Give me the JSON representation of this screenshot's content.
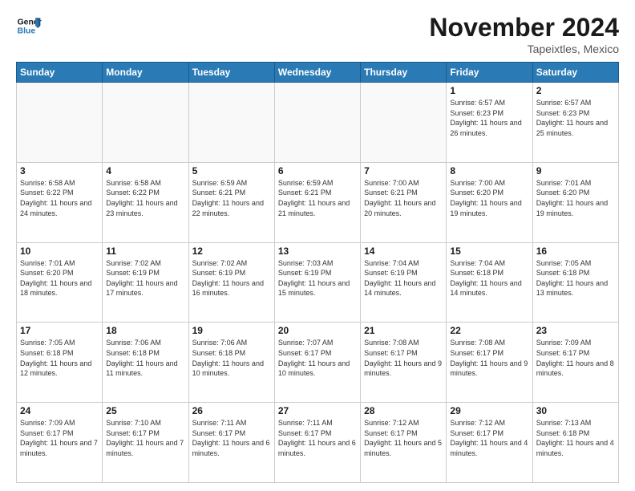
{
  "logo": {
    "line1": "General",
    "line2": "Blue"
  },
  "title": "November 2024",
  "location": "Tapeixtles, Mexico",
  "days_header": [
    "Sunday",
    "Monday",
    "Tuesday",
    "Wednesday",
    "Thursday",
    "Friday",
    "Saturday"
  ],
  "weeks": [
    [
      {
        "day": "",
        "detail": ""
      },
      {
        "day": "",
        "detail": ""
      },
      {
        "day": "",
        "detail": ""
      },
      {
        "day": "",
        "detail": ""
      },
      {
        "day": "",
        "detail": ""
      },
      {
        "day": "1",
        "detail": "Sunrise: 6:57 AM\nSunset: 6:23 PM\nDaylight: 11 hours\nand 26 minutes."
      },
      {
        "day": "2",
        "detail": "Sunrise: 6:57 AM\nSunset: 6:23 PM\nDaylight: 11 hours\nand 25 minutes."
      }
    ],
    [
      {
        "day": "3",
        "detail": "Sunrise: 6:58 AM\nSunset: 6:22 PM\nDaylight: 11 hours\nand 24 minutes."
      },
      {
        "day": "4",
        "detail": "Sunrise: 6:58 AM\nSunset: 6:22 PM\nDaylight: 11 hours\nand 23 minutes."
      },
      {
        "day": "5",
        "detail": "Sunrise: 6:59 AM\nSunset: 6:21 PM\nDaylight: 11 hours\nand 22 minutes."
      },
      {
        "day": "6",
        "detail": "Sunrise: 6:59 AM\nSunset: 6:21 PM\nDaylight: 11 hours\nand 21 minutes."
      },
      {
        "day": "7",
        "detail": "Sunrise: 7:00 AM\nSunset: 6:21 PM\nDaylight: 11 hours\nand 20 minutes."
      },
      {
        "day": "8",
        "detail": "Sunrise: 7:00 AM\nSunset: 6:20 PM\nDaylight: 11 hours\nand 19 minutes."
      },
      {
        "day": "9",
        "detail": "Sunrise: 7:01 AM\nSunset: 6:20 PM\nDaylight: 11 hours\nand 19 minutes."
      }
    ],
    [
      {
        "day": "10",
        "detail": "Sunrise: 7:01 AM\nSunset: 6:20 PM\nDaylight: 11 hours\nand 18 minutes."
      },
      {
        "day": "11",
        "detail": "Sunrise: 7:02 AM\nSunset: 6:19 PM\nDaylight: 11 hours\nand 17 minutes."
      },
      {
        "day": "12",
        "detail": "Sunrise: 7:02 AM\nSunset: 6:19 PM\nDaylight: 11 hours\nand 16 minutes."
      },
      {
        "day": "13",
        "detail": "Sunrise: 7:03 AM\nSunset: 6:19 PM\nDaylight: 11 hours\nand 15 minutes."
      },
      {
        "day": "14",
        "detail": "Sunrise: 7:04 AM\nSunset: 6:19 PM\nDaylight: 11 hours\nand 14 minutes."
      },
      {
        "day": "15",
        "detail": "Sunrise: 7:04 AM\nSunset: 6:18 PM\nDaylight: 11 hours\nand 14 minutes."
      },
      {
        "day": "16",
        "detail": "Sunrise: 7:05 AM\nSunset: 6:18 PM\nDaylight: 11 hours\nand 13 minutes."
      }
    ],
    [
      {
        "day": "17",
        "detail": "Sunrise: 7:05 AM\nSunset: 6:18 PM\nDaylight: 11 hours\nand 12 minutes."
      },
      {
        "day": "18",
        "detail": "Sunrise: 7:06 AM\nSunset: 6:18 PM\nDaylight: 11 hours\nand 11 minutes."
      },
      {
        "day": "19",
        "detail": "Sunrise: 7:06 AM\nSunset: 6:18 PM\nDaylight: 11 hours\nand 10 minutes."
      },
      {
        "day": "20",
        "detail": "Sunrise: 7:07 AM\nSunset: 6:17 PM\nDaylight: 11 hours\nand 10 minutes."
      },
      {
        "day": "21",
        "detail": "Sunrise: 7:08 AM\nSunset: 6:17 PM\nDaylight: 11 hours\nand 9 minutes."
      },
      {
        "day": "22",
        "detail": "Sunrise: 7:08 AM\nSunset: 6:17 PM\nDaylight: 11 hours\nand 9 minutes."
      },
      {
        "day": "23",
        "detail": "Sunrise: 7:09 AM\nSunset: 6:17 PM\nDaylight: 11 hours\nand 8 minutes."
      }
    ],
    [
      {
        "day": "24",
        "detail": "Sunrise: 7:09 AM\nSunset: 6:17 PM\nDaylight: 11 hours\nand 7 minutes."
      },
      {
        "day": "25",
        "detail": "Sunrise: 7:10 AM\nSunset: 6:17 PM\nDaylight: 11 hours\nand 7 minutes."
      },
      {
        "day": "26",
        "detail": "Sunrise: 7:11 AM\nSunset: 6:17 PM\nDaylight: 11 hours\nand 6 minutes."
      },
      {
        "day": "27",
        "detail": "Sunrise: 7:11 AM\nSunset: 6:17 PM\nDaylight: 11 hours\nand 6 minutes."
      },
      {
        "day": "28",
        "detail": "Sunrise: 7:12 AM\nSunset: 6:17 PM\nDaylight: 11 hours\nand 5 minutes."
      },
      {
        "day": "29",
        "detail": "Sunrise: 7:12 AM\nSunset: 6:17 PM\nDaylight: 11 hours\nand 4 minutes."
      },
      {
        "day": "30",
        "detail": "Sunrise: 7:13 AM\nSunset: 6:18 PM\nDaylight: 11 hours\nand 4 minutes."
      }
    ]
  ]
}
